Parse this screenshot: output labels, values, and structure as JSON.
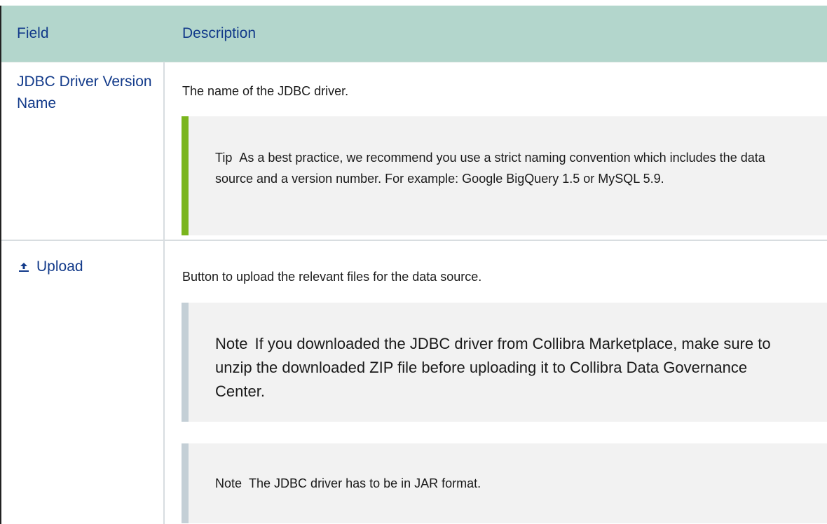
{
  "header": {
    "field": "Field",
    "description": "Description"
  },
  "rows": [
    {
      "field": "JDBC Driver Version Name",
      "description": "The name of the JDBC driver.",
      "callouts": [
        {
          "label": "Tip",
          "text": "As a best practice, we recommend you use a strict naming convention which includes the data source and a version number. For example: Google BigQuery 1.5 or MySQL 5.9."
        }
      ]
    },
    {
      "field_icon": "upload-icon",
      "field": "Upload",
      "description": "Button to upload the relevant files for the data source.",
      "callouts": [
        {
          "label": "Note",
          "text": "If you downloaded the JDBC driver from Collibra Marketplace, make sure to unzip the downloaded ZIP file before uploading it to Collibra Data Governance Center."
        },
        {
          "label": "Note",
          "text": "The JDBC driver has to be in JAR format."
        }
      ]
    }
  ],
  "colors": {
    "header_bg": "#b3d6cc",
    "header_text": "#123a8a",
    "tip_bar": "#7ab51d",
    "note_bar": "#c4cfd6",
    "callout_bg": "#f2f2f2"
  }
}
